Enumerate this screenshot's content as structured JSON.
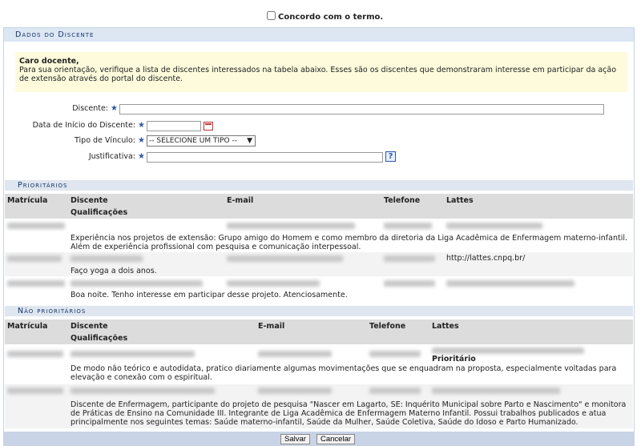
{
  "agree": {
    "label": "Concordo com o termo."
  },
  "section": {
    "title": "Dados do Discente"
  },
  "notice": {
    "greeting": "Caro docente,",
    "text": "Para sua orientação, verifique a lista de discentes interessados na tabela abaixo. Esses são os discentes que demonstraram interesse em participar da ação de extensão através do portal do discente."
  },
  "form": {
    "discente_label": "Discente:",
    "data_label": "Data de Início do Discente:",
    "tipo_label": "Tipo de Vínculo:",
    "tipo_value": "-- SELECIONE UM TIPO --",
    "justificativa_label": "Justificativa:",
    "required_mark": "★",
    "help_mark": "?"
  },
  "prioritarios": {
    "title": "Prioritários",
    "headers": {
      "matricula": "Matrícula",
      "discente": "Discente",
      "email": "E-mail",
      "telefone": "Telefone",
      "lattes": "Lattes",
      "qualificacoes": "Qualificações"
    },
    "rows": [
      {
        "lattes": "",
        "qualificacoes": "Experiência nos projetos de extensão: Grupo amigo do Homem e como membro da diretoria da Liga Acadêmica de Enfermagem materno-infantil. Além de experiência profissional com pesquisa e comunicação interpessoal."
      },
      {
        "lattes": "http://lattes.cnpq.br/",
        "qualificacoes": "Faço yoga a dois anos."
      },
      {
        "lattes": "",
        "qualificacoes": "Boa noite. Tenho interesse em participar desse projeto. Atenciosamente."
      }
    ]
  },
  "nao_prioritarios": {
    "title": "Não prioritários",
    "headers": {
      "matricula": "Matrícula",
      "discente": "Discente",
      "email": "E-mail",
      "telefone": "Telefone",
      "lattes": "Lattes",
      "qualificacoes": "Qualificações"
    },
    "rows": [
      {
        "badge": "Prioritário",
        "qualificacoes": "De modo não teórico e autodidata, pratico diariamente algumas movimentações que se enquadram na proposta, especialmente voltadas para elevação e conexão com o espiritual."
      },
      {
        "badge": "",
        "qualificacoes": "Discente de Enfermagem, participante do projeto de pesquisa \"Nascer em Lagarto, SE: Inquérito Municipal sobre Parto e Nascimento\" e monitora de Práticas de Ensino na Comunidade III. Integrante de Liga Acadêmica de Enfermagem Materno Infantil. Possui trabalhos publicados e atua principalmente nos seguintes temas: Saúde materno-infantil, Saúde da Mulher, Saúde Coletiva, Saúde do Idoso e Parto Humanizado."
      }
    ]
  },
  "buttons": {
    "save": "Salvar",
    "cancel": "Cancelar"
  }
}
